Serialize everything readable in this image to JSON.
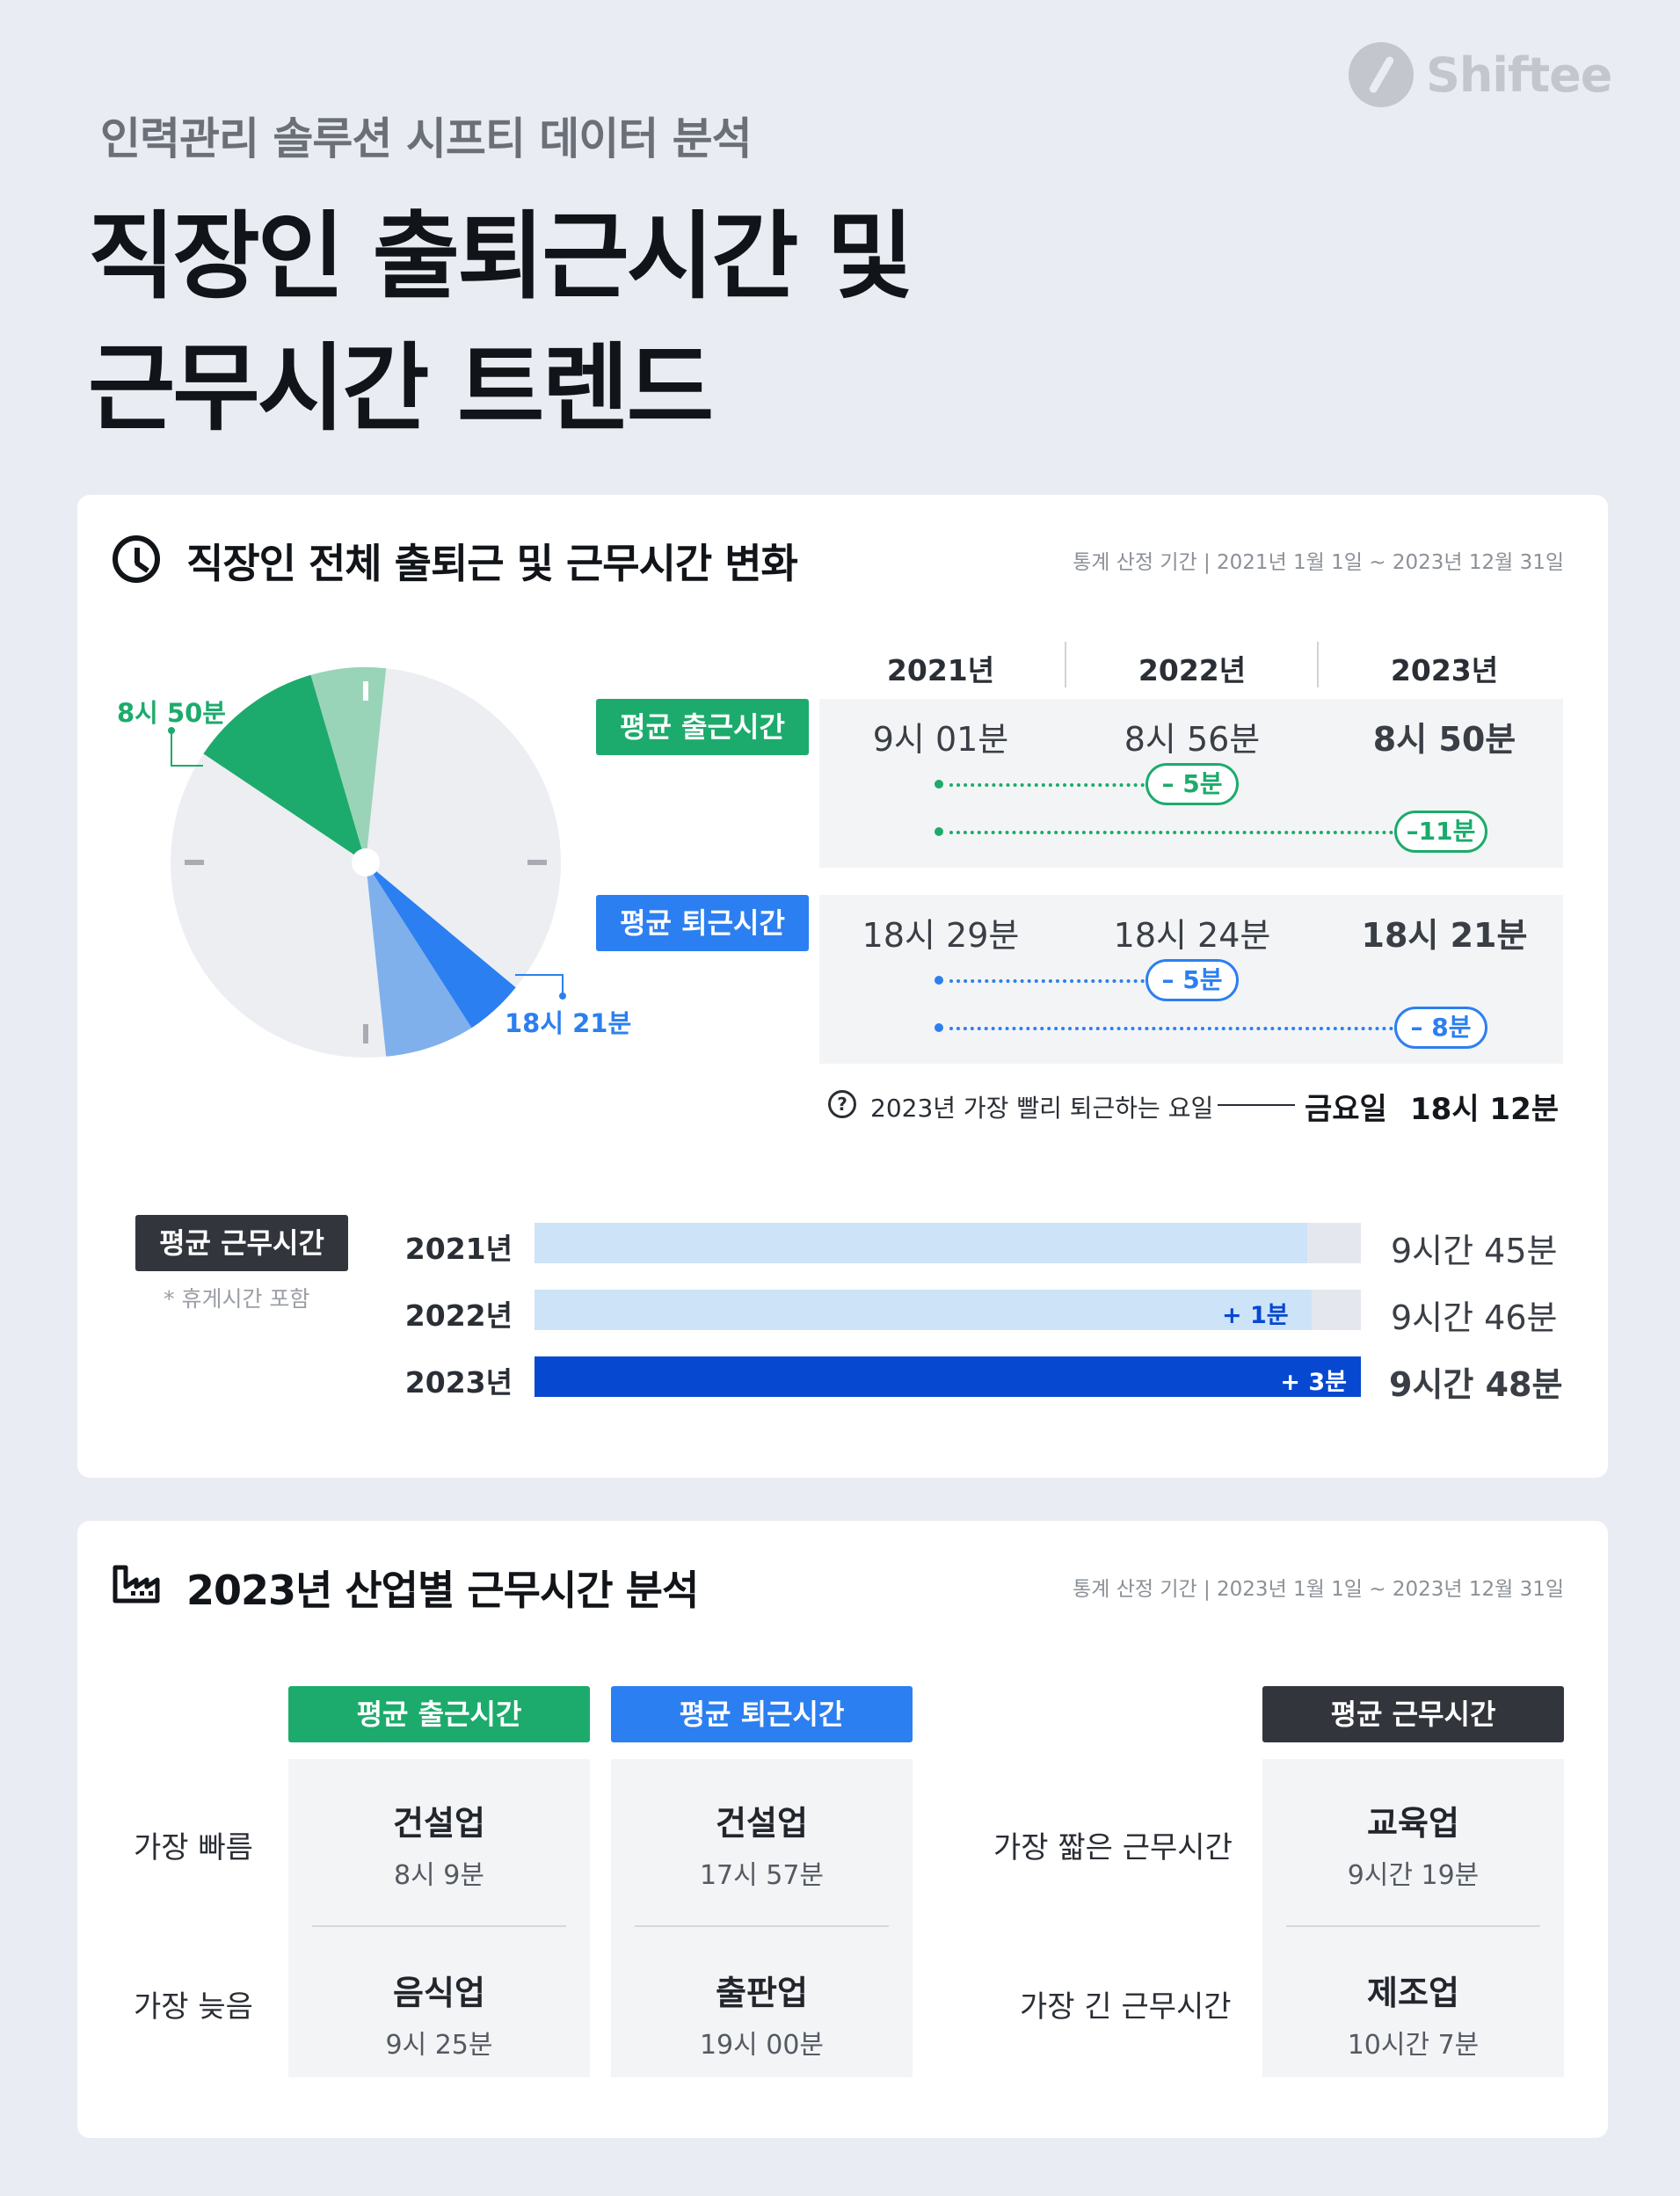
{
  "brand": {
    "name": "Shiftee"
  },
  "header": {
    "subtitle": "인력관리 솔루션 시프티 데이터 분석",
    "title_line1": "직장인 출퇴근시간 및",
    "title_line2": "근무시간 트렌드"
  },
  "overview": {
    "title": "직장인 전체 출퇴근 및 근무시간 변화",
    "period": "통계 산정 기간 | 2021년 1월 1일 ~ 2023년 12월 31일",
    "clock_labels": {
      "arrive": "8시 50분",
      "leave": "18시 21분"
    },
    "years": [
      "2021년",
      "2022년",
      "2023년"
    ],
    "arrive": {
      "label": "평균 출근시간",
      "values": [
        "9시 01분",
        "8시 56분",
        "8시 50분"
      ],
      "delta_short": "– 5분",
      "delta_long": "–11분"
    },
    "leave": {
      "label": "평균 퇴근시간",
      "values": [
        "18시 29분",
        "18시 24분",
        "18시 21분"
      ],
      "delta_short": "– 5분",
      "delta_long": "– 8분"
    },
    "note": {
      "question": "?",
      "text": "2023년 가장 빨리 퇴근하는 요일",
      "day": "금요일",
      "time": "18시 12분"
    },
    "work_hours": {
      "label": "평균 근무시간",
      "footnote": "* 휴게시간 포함",
      "rows": [
        {
          "year": "2021년",
          "value": "9시간 45분",
          "delta": "",
          "fraction": 0.935
        },
        {
          "year": "2022년",
          "value": "9시간 46분",
          "delta": "+ 1분",
          "fraction": 0.94
        },
        {
          "year": "2023년",
          "value": "9시간 48분",
          "delta": "+ 3분",
          "fraction": 1.0
        }
      ]
    }
  },
  "industry": {
    "title": "2023년 산업별 근무시간 분석",
    "period": "통계 산정 기간 | 2023년 1월 1일 ~ 2023년 12월 31일",
    "columns": [
      "평균 출근시간",
      "평균 퇴근시간",
      "평균 근무시간"
    ],
    "row_labels": [
      "가장 빠름",
      "가장 늦음"
    ],
    "work_row_labels": [
      "가장 짧은 근무시간",
      "가장 긴 근무시간"
    ],
    "arrive": [
      {
        "name": "건설업",
        "value": "8시 9분"
      },
      {
        "name": "음식업",
        "value": "9시 25분"
      }
    ],
    "leave": [
      {
        "name": "건설업",
        "value": "17시 57분"
      },
      {
        "name": "출판업",
        "value": "19시 00분"
      }
    ],
    "work": [
      {
        "name": "교육업",
        "value": "9시간 19분"
      },
      {
        "name": "제조업",
        "value": "10시간 7분"
      }
    ]
  },
  "colors": {
    "green": "#1cab6c",
    "green_light": "#9ad4b8",
    "blue": "#2c7ff0",
    "blue_light": "#7fb0ec",
    "dark_blue": "#0748d1",
    "light_bar": "#cde3f8",
    "dark_tag": "#32363c"
  }
}
